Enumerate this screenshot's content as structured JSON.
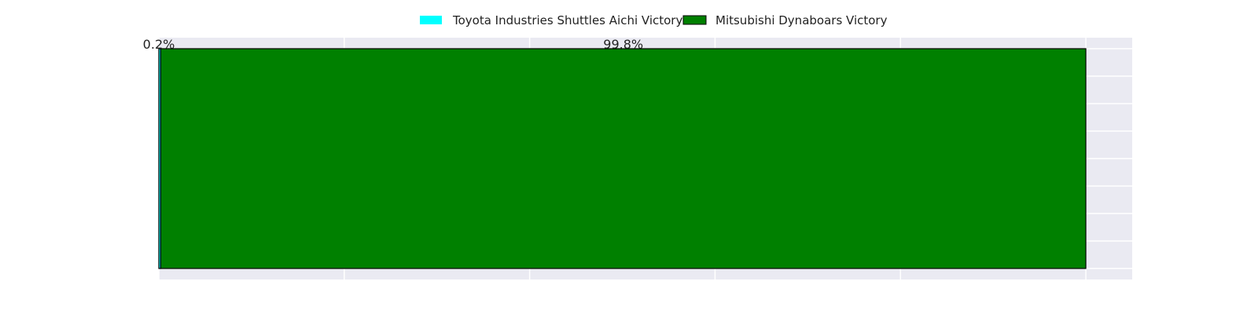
{
  "chart_data": {
    "type": "bar",
    "orientation": "horizontal",
    "stacked": true,
    "categories": [
      ""
    ],
    "series": [
      {
        "name": "Toyota Industries Shuttles Aichi Victory",
        "values": [
          0.2
        ],
        "color": "#00ffff",
        "label": "0.2%"
      },
      {
        "name": "Mitsubishi Dynaboars Victory",
        "values": [
          99.8
        ],
        "color": "#008000",
        "label": "99.8%"
      }
    ],
    "xlim": [
      0,
      105
    ],
    "x_gridlines": [
      0,
      20,
      40,
      60,
      80,
      100
    ],
    "y_gridline_count": 9,
    "grid": true,
    "legend": "top-center",
    "background_color": "#eaeaf2",
    "bar_edge_color": "#000000"
  }
}
